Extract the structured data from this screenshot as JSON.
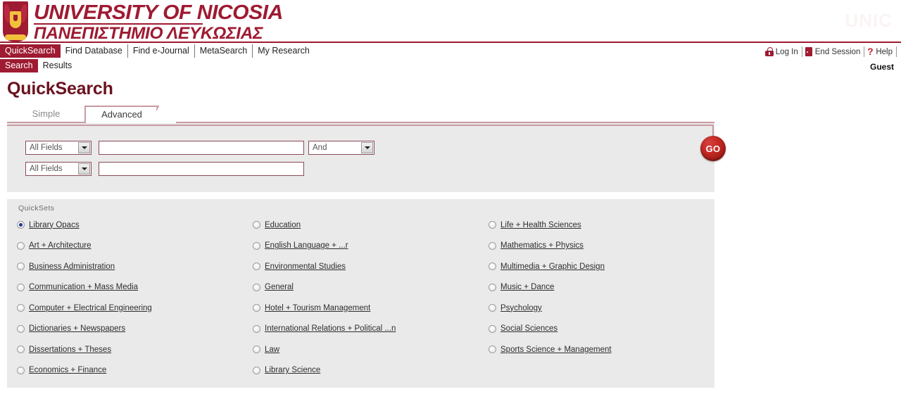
{
  "banner": {
    "logo_line1": "UNIVERSITY OF NICOSIA",
    "logo_line2": "ΠΑΝΕΠΙΣΤΗΜΙΟ ΛΕΥΚΩΣΙΑΣ",
    "watermark": "UNIC",
    "brand_color": "#9e1b32"
  },
  "nav_main": [
    {
      "label": "QuickSearch",
      "active": true
    },
    {
      "label": "Find Database",
      "active": false
    },
    {
      "label": "Find e-Journal",
      "active": false
    },
    {
      "label": "MetaSearch",
      "active": false
    },
    {
      "label": "My Research",
      "active": false
    }
  ],
  "nav_sub": [
    {
      "label": "Search",
      "active": true
    },
    {
      "label": "Results",
      "active": false
    }
  ],
  "header_right": {
    "login": "Log In",
    "end_session": "End Session",
    "help": "Help",
    "user": "Guest",
    "login_icon": "lock-icon",
    "end_session_icon": "door-exit-icon",
    "help_icon": "question-mark-icon"
  },
  "page": {
    "title": "QuickSearch"
  },
  "mode_tabs": [
    {
      "label": "Simple",
      "active": false
    },
    {
      "label": "Advanced",
      "active": true
    }
  ],
  "search_form": {
    "row1": {
      "field_select": "All Fields",
      "query_value": "",
      "query_placeholder": "",
      "boolean_select": "And"
    },
    "row2": {
      "field_select": "All Fields",
      "query_value": "",
      "query_placeholder": ""
    },
    "go_label": "GO"
  },
  "quicksets": {
    "title": "QuickSets",
    "columns": [
      [
        {
          "label": "Library Opacs",
          "selected": true
        },
        {
          "label": "Art + Architecture",
          "selected": false
        },
        {
          "label": "Business Administration",
          "selected": false
        },
        {
          "label": "Communication + Mass Media",
          "selected": false
        },
        {
          "label": "Computer + Electrical Engineering",
          "selected": false
        },
        {
          "label": "Dictionaries + Newspapers",
          "selected": false
        },
        {
          "label": "Dissertations + Theses",
          "selected": false
        },
        {
          "label": "Economics + Finance",
          "selected": false
        }
      ],
      [
        {
          "label": "Education",
          "selected": false
        },
        {
          "label": "English Language + ...r",
          "selected": false
        },
        {
          "label": "Environmental Studies",
          "selected": false
        },
        {
          "label": "General",
          "selected": false
        },
        {
          "label": "Hotel + Tourism Management",
          "selected": false
        },
        {
          "label": "International Relations + Political ...n",
          "selected": false
        },
        {
          "label": "Law",
          "selected": false
        },
        {
          "label": "Library Science",
          "selected": false
        }
      ],
      [
        {
          "label": "Life + Health Sciences",
          "selected": false
        },
        {
          "label": "Mathematics + Physics",
          "selected": false
        },
        {
          "label": "Multimedia + Graphic Design",
          "selected": false
        },
        {
          "label": "Music + Dance",
          "selected": false
        },
        {
          "label": "Psychology",
          "selected": false
        },
        {
          "label": "Social Sciences",
          "selected": false
        },
        {
          "label": "Sports Science + Management",
          "selected": false
        }
      ]
    ]
  }
}
